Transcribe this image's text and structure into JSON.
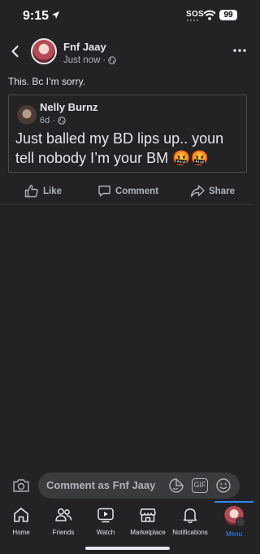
{
  "status_bar": {
    "time": "9:15",
    "sos": "SOS",
    "battery": "99"
  },
  "post": {
    "author": "Fnf Jaay",
    "time": "Just now",
    "separator": "·",
    "text": "This. Bc I’m sorry."
  },
  "shared_post": {
    "author": "Nelly Burnz",
    "time": "6d",
    "separator": "·",
    "text": "Just balled my BD lips up.. youn tell nobody I’m your BM 🤬🤬"
  },
  "actions": {
    "like_label": "Like",
    "comment_label": "Comment",
    "share_label": "Share"
  },
  "comment_bar": {
    "placeholder": "Comment as Fnf Jaay",
    "gif_label": "GIF"
  },
  "tabs": [
    {
      "label": "Home",
      "icon": "home-icon",
      "active": false
    },
    {
      "label": "Friends",
      "icon": "friends-icon",
      "active": false
    },
    {
      "label": "Watch",
      "icon": "watch-icon",
      "active": false
    },
    {
      "label": "Marketplace",
      "icon": "marketplace-icon",
      "active": false
    },
    {
      "label": "Notifications",
      "icon": "bell-icon",
      "active": false
    },
    {
      "label": "Menu",
      "icon": "profile-avatar",
      "active": true
    }
  ],
  "colors": {
    "background": "#232325",
    "text": "#e4e6eb",
    "secondary_text": "#b0b3b8",
    "accent": "#2d88ff"
  }
}
